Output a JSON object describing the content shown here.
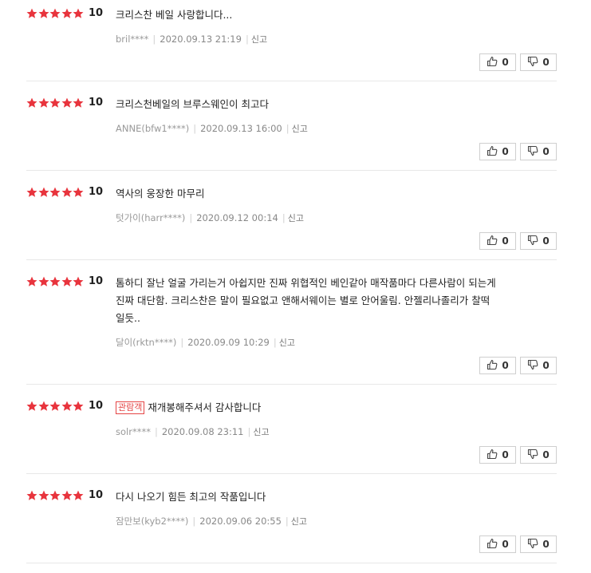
{
  "colors": {
    "star": "#e8343d",
    "badge": "#e54545"
  },
  "icons": {
    "star": "star-icon",
    "like": "thumbs-up-icon",
    "dislike": "thumbs-down-icon"
  },
  "report_label": "신고",
  "reviews": [
    {
      "rating": 5,
      "score": "10",
      "badge": "",
      "lines": [
        "크리스찬 베일 사랑합니다..."
      ],
      "user": "bril****",
      "date": "2020.09.13 21:19",
      "likes": "0",
      "dislikes": "0"
    },
    {
      "rating": 5,
      "score": "10",
      "badge": "",
      "lines": [
        "크리스천베일의 브루스웨인이 최고다"
      ],
      "user": "ANNE(bfw1****)",
      "date": "2020.09.13 16:00",
      "likes": "0",
      "dislikes": "0"
    },
    {
      "rating": 5,
      "score": "10",
      "badge": "",
      "lines": [
        "역사의 웅장한 마무리"
      ],
      "user": "텃가이(harr****)",
      "date": "2020.09.12 00:14",
      "likes": "0",
      "dislikes": "0"
    },
    {
      "rating": 5,
      "score": "10",
      "badge": "",
      "lines": [
        "톰하디 잘난 얼굴 가리는거 아쉽지만 진짜 위협적인 베인같아 매작품마다 다른사람이 되는게",
        "진짜 대단함. 크리스찬은 말이 필요없고 앤해서웨이는 별로 안어울림. 안젤리나졸리가 찰떡",
        "일듯.."
      ],
      "user": "달이(rktn****)",
      "date": "2020.09.09 10:29",
      "likes": "0",
      "dislikes": "0"
    },
    {
      "rating": 5,
      "score": "10",
      "badge": "관람객",
      "lines": [
        "재개봉해주셔서 감사합니다"
      ],
      "user": "solr****",
      "date": "2020.09.08 23:11",
      "likes": "0",
      "dislikes": "0"
    },
    {
      "rating": 5,
      "score": "10",
      "badge": "",
      "lines": [
        "다시 나오기 힘든 최고의 작품입니다"
      ],
      "user": "잠만보(kyb2****)",
      "date": "2020.09.06 20:55",
      "likes": "0",
      "dislikes": "0"
    }
  ]
}
